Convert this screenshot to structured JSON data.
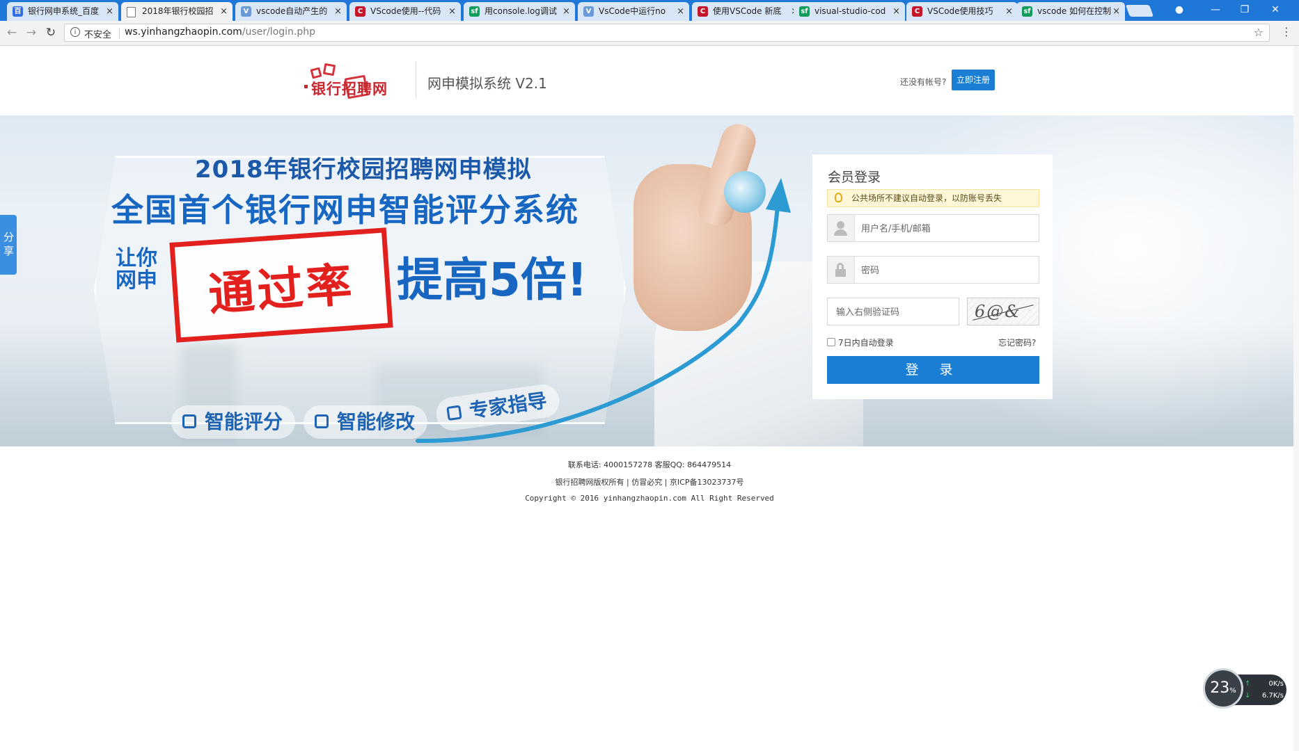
{
  "browser": {
    "tabs": [
      {
        "title": "银行网申系统_百度",
        "icon": "baidu-icon"
      },
      {
        "title": "2018年银行校园招",
        "icon": "page-icon",
        "active": true
      },
      {
        "title": "vscode自动产生的",
        "icon": "vs-icon"
      },
      {
        "title": "VScode使用--代码",
        "icon": "csdn-icon"
      },
      {
        "title": "用console.log调试",
        "icon": "sf-icon"
      },
      {
        "title": "VsCode中运行no",
        "icon": "vs-icon"
      },
      {
        "title": "使用VSCode 新底",
        "icon": "csdn-icon"
      },
      {
        "title": "visual-studio-cod",
        "icon": "sf-icon"
      },
      {
        "title": "VSCode使用技巧",
        "icon": "csdn-icon"
      },
      {
        "title": "vscode 如何在控制",
        "icon": "sf-icon"
      }
    ],
    "security_label": "不安全",
    "url_host": "ws.yinhangzhaopin.com",
    "url_path": "/user/login.php"
  },
  "header": {
    "logo_text": "银行招聘网",
    "system_title": "网申模拟系统 V2.1",
    "no_account_text": "还没有帐号?",
    "register_label": "立即注册"
  },
  "banner": {
    "line1": "2018年银行校园招聘网申模拟",
    "line2": "全国首个银行网申智能评分系统",
    "let_you": "让你网申",
    "stamp": "通过率",
    "boost": "提高5倍!",
    "pills": [
      "智能评分",
      "智能修改",
      "专家指导"
    ]
  },
  "login": {
    "title": "会员登录",
    "notice": "公共场所不建议自动登录，以防账号丢失",
    "username_placeholder": "用户名/手机/邮箱",
    "password_placeholder": "密码",
    "captcha_placeholder": "输入右侧验证码",
    "captcha_text": "6@&",
    "remember_label": "7日内自动登录",
    "forgot_label": "忘记密码?",
    "submit_label": "登 录"
  },
  "share_tab": "分享",
  "footer": {
    "contact": "联系电话: 4000157278 客服QQ: 864479514",
    "rights": "银行招聘网版权所有 | 仿冒必究 | 京ICP备13023737号",
    "copyright": "Copyright © 2016 yinhangzhaopin.com All Right Reserved"
  },
  "speed_widget": {
    "cpu": "23",
    "cpu_unit": "%",
    "upload": "0K/s",
    "download": "6.7K/s"
  }
}
